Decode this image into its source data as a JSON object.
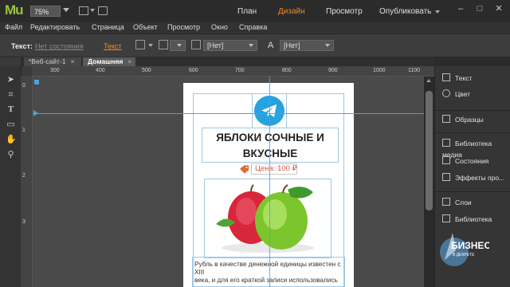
{
  "app": {
    "logo": "Mu",
    "zoom": "75%"
  },
  "modes": {
    "plan": "План",
    "design": "Дизайн",
    "preview": "Просмотр",
    "publish": "Опубликовать"
  },
  "window": {
    "minimize": "–",
    "maximize": "□",
    "close": "✕"
  },
  "menu": [
    "Файл",
    "Редактировать",
    "Страница",
    "Объект",
    "Просмотр",
    "Окно",
    "Справка"
  ],
  "control": {
    "text_label": "Текст:",
    "state": "Нет состояния",
    "text_link": "Текст",
    "list1": "[Нет]",
    "list2": "[Нет]"
  },
  "tabs": [
    {
      "label": "*Веб-сайт-1",
      "close": "×"
    },
    {
      "label": "Домашняя",
      "close": "×"
    }
  ],
  "ruler_top": [
    "300",
    "400",
    "500",
    "600",
    "700",
    "800",
    "900",
    "1000",
    "1100"
  ],
  "ruler_left": [
    "0",
    "1",
    "2",
    "3"
  ],
  "page": {
    "title_line1": "ЯБЛОКИ СОЧНЫЕ И",
    "title_line2": "ВКУСНЫЕ",
    "price": "Цена: 100 ₽",
    "body_line1": "Рубль в качестве денежной единицы известен с XIII",
    "body_line2": "века, и для его краткой записи использовались"
  },
  "panel": [
    "Текст",
    "Цвет",
    "Образцы",
    "Библиотека медиа",
    "Состояния",
    "Эффекты про...",
    "Слои",
    "Библиотека"
  ],
  "watermark": {
    "line1": "БИЗНЕС",
    "line2": "В ДЕКРЕТЕ"
  },
  "colors": {
    "accent": "#f08a2e",
    "guide": "#4aa3df",
    "telegram": "#27a2de",
    "logo": "#9bc43a"
  },
  "icons": [
    "telegram-icon",
    "price-tag-icon",
    "apple-image"
  ]
}
